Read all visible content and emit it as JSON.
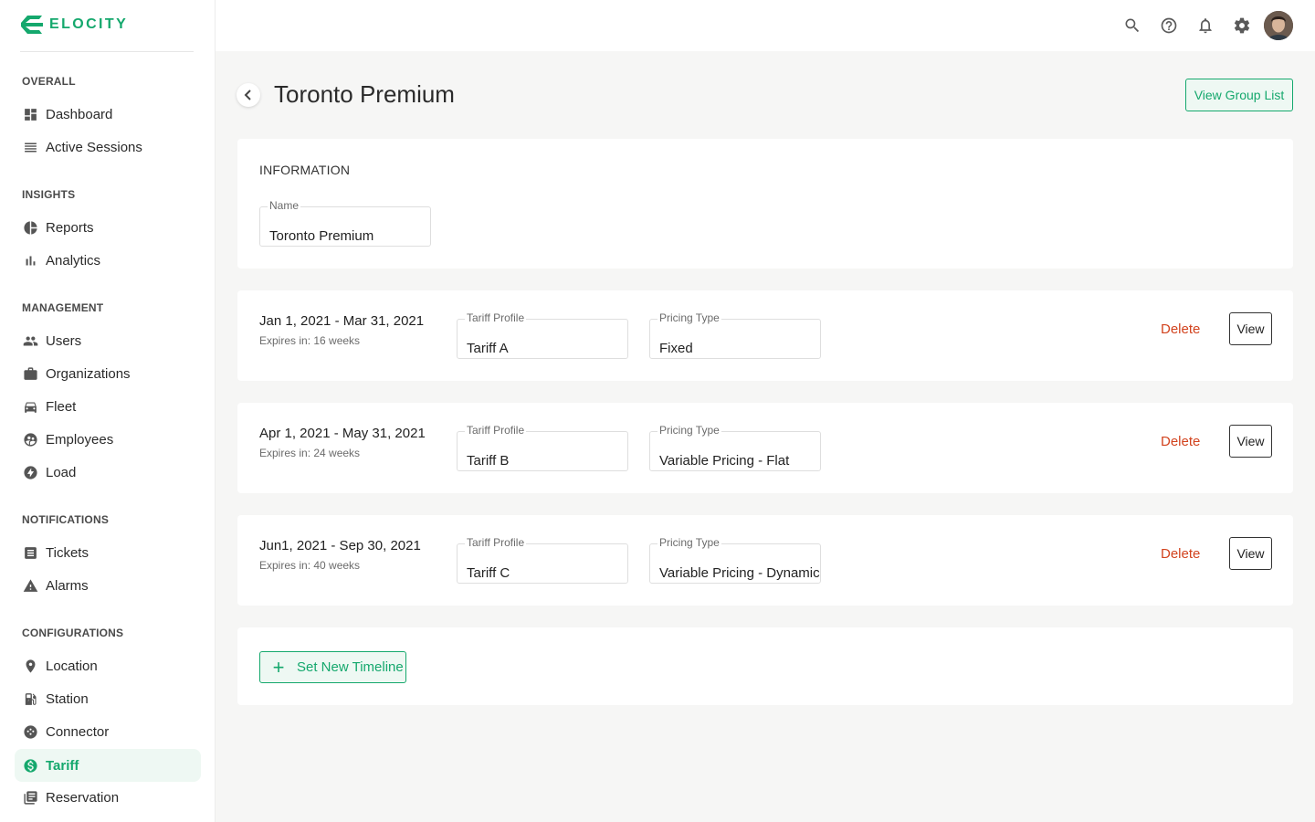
{
  "brand": {
    "name": "ELOCITY",
    "accent": "#15a86d"
  },
  "sidebar": {
    "sections": [
      {
        "title": "OVERALL"
      },
      {
        "title": "INSIGHTS"
      },
      {
        "title": "MANAGEMENT"
      },
      {
        "title": "NOTIFICATIONS"
      },
      {
        "title": "CONFIGURATIONS"
      }
    ],
    "items": [
      {
        "label": "Dashboard",
        "icon": "dashboard-icon"
      },
      {
        "label": "Active Sessions",
        "icon": "list-icon"
      },
      {
        "label": "Reports",
        "icon": "pie-chart-icon"
      },
      {
        "label": "Analytics",
        "icon": "bar-chart-icon"
      },
      {
        "label": "Users",
        "icon": "people-icon"
      },
      {
        "label": "Organizations",
        "icon": "briefcase-icon"
      },
      {
        "label": "Fleet",
        "icon": "car-icon"
      },
      {
        "label": "Employees",
        "icon": "employee-icon"
      },
      {
        "label": "Load",
        "icon": "bolt-icon"
      },
      {
        "label": "Tickets",
        "icon": "ticket-icon"
      },
      {
        "label": "Alarms",
        "icon": "warning-icon"
      },
      {
        "label": "Location",
        "icon": "pin-icon"
      },
      {
        "label": "Station",
        "icon": "ev-station-icon"
      },
      {
        "label": "Connector",
        "icon": "connector-icon"
      },
      {
        "label": "Tariff",
        "icon": "dollar-icon",
        "active": true
      },
      {
        "label": "Reservation",
        "icon": "reservation-icon"
      }
    ]
  },
  "topbar": {
    "icons": [
      "search-icon",
      "help-icon",
      "bell-icon",
      "gear-icon",
      "avatar"
    ]
  },
  "page": {
    "title": "Toronto Premium",
    "view_group_label": "View Group List",
    "information": {
      "heading": "INFORMATION",
      "name_label": "Name",
      "name_value": "Toronto Premium"
    },
    "timelines": [
      {
        "date": "Jan 1, 2021 - Mar 31, 2021",
        "expires": "Expires in: 16 weeks",
        "tariff_label": "Tariff Profile",
        "tariff": "Tariff A",
        "pricing_label": "Pricing Type",
        "pricing": "Fixed",
        "delete": "Delete",
        "view": "View"
      },
      {
        "date": "Apr 1, 2021 - May 31, 2021",
        "expires": "Expires in: 24 weeks",
        "tariff_label": "Tariff Profile",
        "tariff": "Tariff B",
        "pricing_label": "Pricing Type",
        "pricing": "Variable Pricing - Flat",
        "delete": "Delete",
        "view": "View"
      },
      {
        "date": "Jun1, 2021 - Sep 30, 2021",
        "expires": "Expires in: 40 weeks",
        "tariff_label": "Tariff Profile",
        "tariff": "Tariff C",
        "pricing_label": "Pricing Type",
        "pricing": "Variable Pricing - Dynamic",
        "delete": "Delete",
        "view": "View"
      }
    ],
    "set_timeline_label": "Set New Timeline"
  }
}
